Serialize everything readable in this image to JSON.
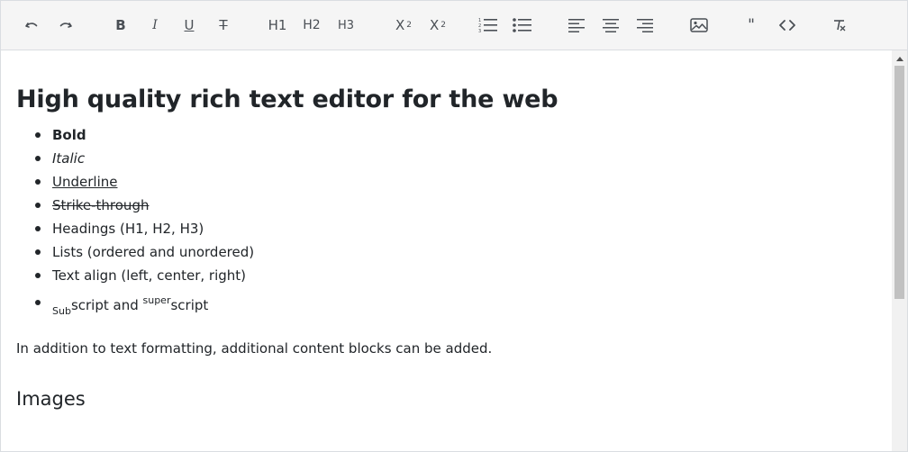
{
  "toolbar": {
    "undo": "undo-icon",
    "redo": "redo-icon",
    "bold": "B",
    "italic": "I",
    "underline": "U",
    "strike": "T",
    "h1": "H1",
    "h2": "H2",
    "h3": "H3",
    "subscript": "X",
    "subscript_mark": "2",
    "superscript": "X",
    "superscript_mark": "2",
    "quote": "\""
  },
  "content": {
    "title": "High quality rich text editor for the web",
    "items": {
      "bold": "Bold",
      "italic": "Italic",
      "underline": "Underline",
      "strike": "Strike-through",
      "headings": "Headings (H1, H2, H3)",
      "lists": "Lists (ordered and unordered)",
      "align": "Text align (left, center, right)",
      "sub_prefix": "Sub",
      "sub_rest": "script and ",
      "sup_prefix": "super",
      "sup_rest": "script"
    },
    "paragraph": "In addition to text formatting, additional content blocks can be added.",
    "section_heading": "Images"
  },
  "colors": {
    "toolbar_bg": "#f5f5f5",
    "icon": "#4a4f55",
    "text": "#212529",
    "scroll_thumb": "#c1c1c1"
  }
}
